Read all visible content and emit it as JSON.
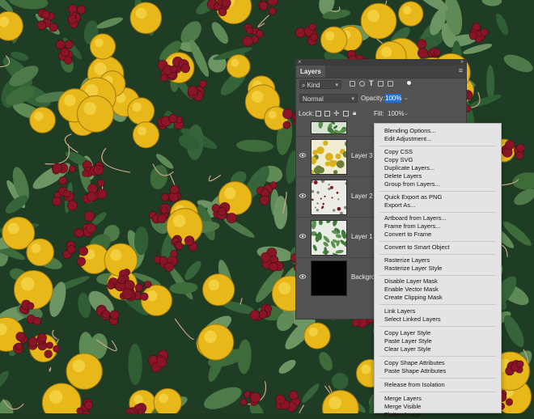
{
  "panel": {
    "close_glyph": "×",
    "collapse_glyph": "»",
    "tab_label": "Layers",
    "menu_glyph": "≡",
    "kind_filter": "Kind",
    "blend_mode": "Normal",
    "opacity_label": "Opacity:",
    "opacity_value": "100%",
    "lock_label": "Lock:",
    "fill_label": "Fill:",
    "fill_value": "100%",
    "filter_icons": [
      "image-filter-icon",
      "adjustment-filter-icon",
      "type-filter-icon",
      "shape-filter-icon",
      "smartobject-filter-icon",
      "filter-toggle-icon"
    ],
    "lock_icons": [
      "lock-pixels-icon",
      "lock-image-icon",
      "lock-position-icon",
      "lock-artboard-icon",
      "lock-all-icon"
    ],
    "layers": [
      {
        "name": "Layer 3",
        "visible": true
      },
      {
        "name": "Layer 2",
        "visible": true
      },
      {
        "name": "Layer 1",
        "visible": true
      },
      {
        "name": "Backgrou",
        "visible": true
      }
    ]
  },
  "context_menu": {
    "items": [
      {
        "label": "Blending Options...",
        "enabled": false
      },
      {
        "label": "Edit Adjustment...",
        "enabled": false
      },
      {
        "label": "Copy CSS",
        "enabled": false
      },
      {
        "label": "Copy SVG",
        "enabled": false
      },
      {
        "label": "Duplicate Layers...",
        "enabled": true
      },
      {
        "label": "Delete Layers",
        "enabled": true
      },
      {
        "label": "Group from Layers...",
        "enabled": true
      },
      {
        "label": "Quick Export as PNG",
        "enabled": true
      },
      {
        "label": "Export As...",
        "enabled": true
      },
      {
        "label": "Artboard from Layers...",
        "enabled": true
      },
      {
        "label": "Frame from Layers...",
        "enabled": true
      },
      {
        "label": "Convert to Frame",
        "enabled": false
      },
      {
        "label": "Convert to Smart Object",
        "enabled": true
      },
      {
        "label": "Rasterize Layers",
        "enabled": false
      },
      {
        "label": "Rasterize Layer Style",
        "enabled": true
      },
      {
        "label": "Disable Layer Mask",
        "enabled": false
      },
      {
        "label": "Enable Vector Mask",
        "enabled": false
      },
      {
        "label": "Create Clipping Mask",
        "enabled": true
      },
      {
        "label": "Link Layers",
        "enabled": true
      },
      {
        "label": "Select Linked Layers",
        "enabled": false
      },
      {
        "label": "Copy Layer Style",
        "enabled": false
      },
      {
        "label": "Paste Layer Style",
        "enabled": true,
        "highlighted": true
      },
      {
        "label": "Clear Layer Style",
        "enabled": true
      },
      {
        "label": "Copy Shape Attributes",
        "enabled": false
      },
      {
        "label": "Paste Shape Attributes",
        "enabled": false
      },
      {
        "label": "Release from Isolation",
        "enabled": false
      },
      {
        "label": "Merge Layers",
        "enabled": true
      },
      {
        "label": "Merge Visible",
        "enabled": true
      },
      {
        "label": "Flatten Image",
        "enabled": true
      }
    ]
  },
  "colors": {
    "panel_bg": "#535353",
    "highlight": "#1f65d6",
    "leaf": "#3d6b3a",
    "lemon": "#e8b81a",
    "berry": "#8a1526"
  }
}
